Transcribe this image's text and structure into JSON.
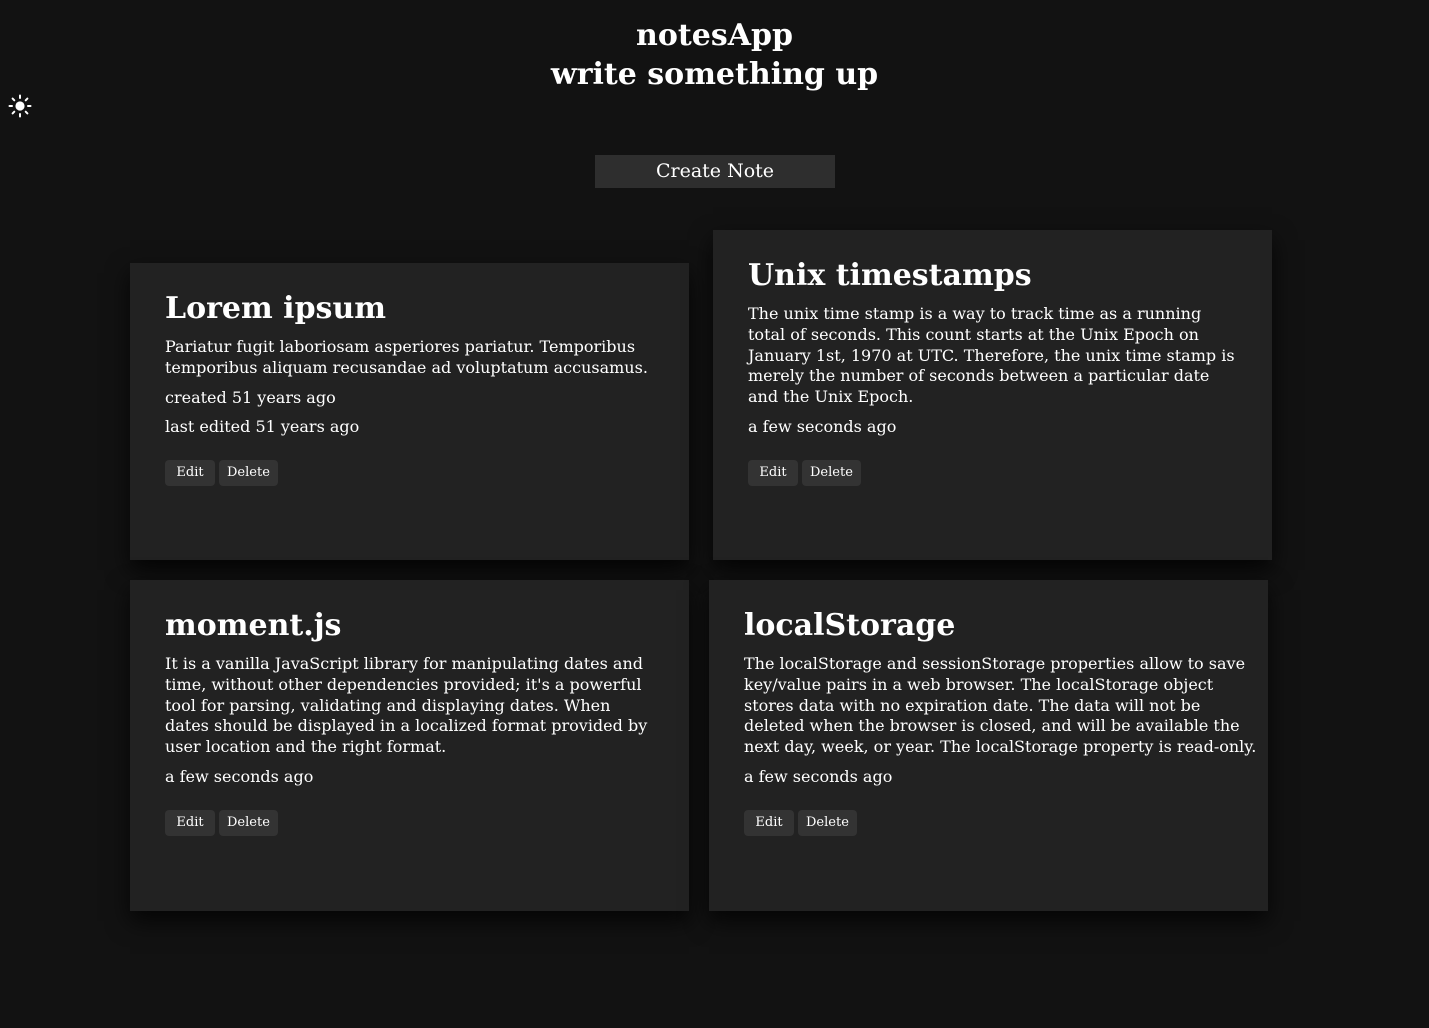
{
  "header": {
    "title": "notesApp",
    "subtitle": "write something up"
  },
  "theme_toggle": {
    "icon": "sun-icon"
  },
  "create_button": {
    "label": "Create Note"
  },
  "buttons": {
    "edit": "Edit",
    "delete": "Delete"
  },
  "notes": [
    {
      "title": "Lorem ipsum",
      "body": "Pariatur fugit laboriosam asperiores pariatur. Temporibus temporibus aliquam recusandae ad voluptatum accusamus.",
      "created": "created 51 years ago",
      "edited": "last edited 51 years ago"
    },
    {
      "title": "Unix timestamps",
      "body": "The unix time stamp is a way to track time as a running total of seconds. This count starts at the Unix Epoch on January 1st, 1970 at UTC. Therefore, the unix time stamp is merely the number of seconds between a particular date and the Unix Epoch.",
      "edited": "a few seconds ago"
    },
    {
      "title": "moment.js",
      "body": "It is a vanilla JavaScript library for manipulating dates and time, without other dependencies provided; it's a powerful tool for parsing, validating and displaying dates. When dates should be displayed in a localized format provided by user location and the right format.",
      "edited": "a few seconds ago"
    },
    {
      "title": "localStorage",
      "body": "The localStorage and sessionStorage properties allow to save key/value pairs in a web browser. The localStorage object stores data with no expiration date. The data will not be deleted when the browser is closed, and will be available the next day, week, or year. The localStorage property is read-only.",
      "edited": "a few seconds ago"
    }
  ]
}
